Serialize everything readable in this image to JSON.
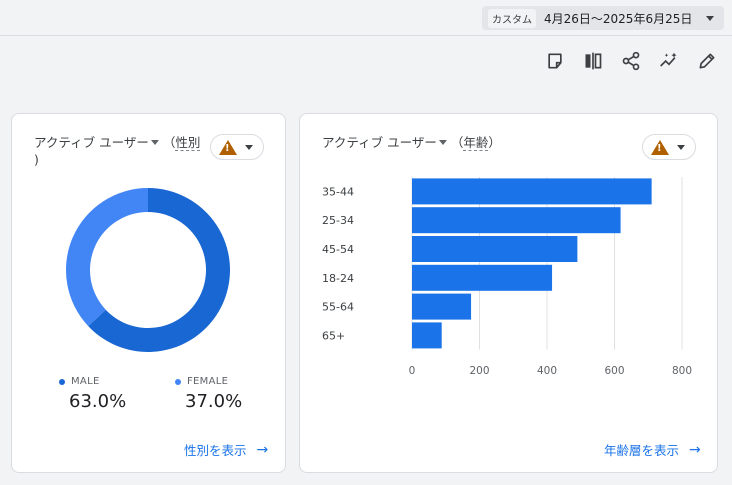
{
  "date_range": {
    "chip": "カスタム",
    "text": "4月26日～2025年6月25日"
  },
  "toolbar_icons": [
    "note-icon",
    "compare-icon",
    "share-icon",
    "insights-icon",
    "edit-icon"
  ],
  "gender_card": {
    "title": "アクティブ ユーザー",
    "dimension": "性別",
    "close_paren": ")",
    "legend": [
      {
        "label": "MALE",
        "value": "63.0%",
        "color": "#1967d2"
      },
      {
        "label": "FEMALE",
        "value": "37.0%",
        "color": "#4285f4"
      }
    ],
    "link": "性別を表示"
  },
  "age_card": {
    "title": "アクティブ ユーザー",
    "dimension": "年齢",
    "link": "年齢層を表示"
  },
  "chart_data": [
    {
      "type": "pie",
      "categories": [
        "MALE",
        "FEMALE"
      ],
      "values": [
        63.0,
        37.0
      ],
      "colors": [
        "#1967d2",
        "#4285f4"
      ]
    },
    {
      "type": "bar",
      "orientation": "horizontal",
      "categories": [
        "35-44",
        "25-34",
        "45-54",
        "18-24",
        "55-64",
        "65+"
      ],
      "values": [
        710,
        618,
        490,
        415,
        175,
        88
      ],
      "xlim": [
        0,
        800
      ],
      "xticks": [
        0,
        200,
        400,
        600,
        800
      ],
      "grid": true,
      "color": "#1a73e8"
    }
  ]
}
